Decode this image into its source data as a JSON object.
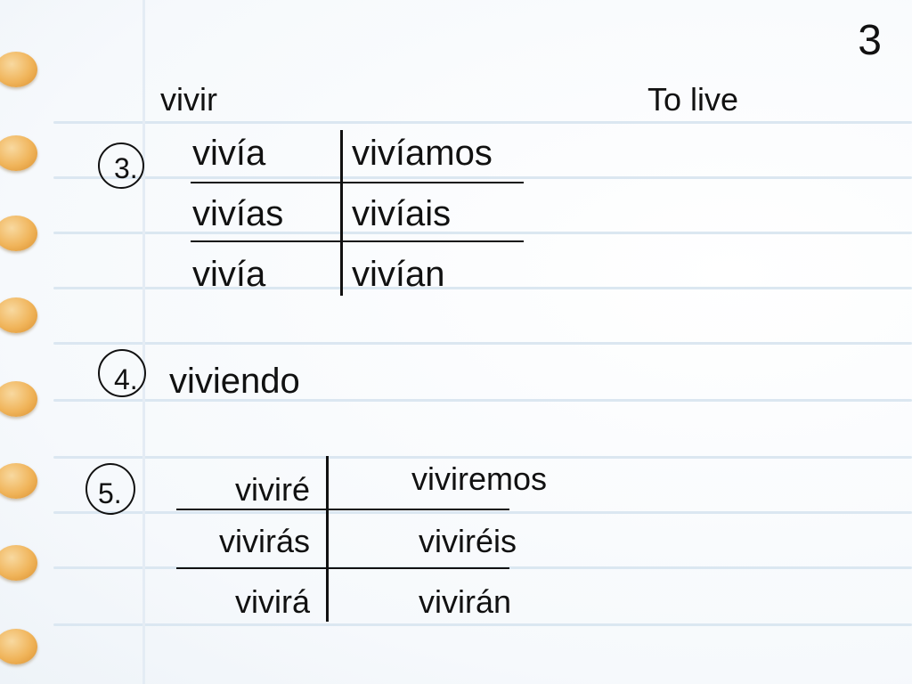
{
  "slide_number": "3",
  "verb": {
    "infinitive": "vivir",
    "translation": "To live"
  },
  "sections": {
    "imperfect": {
      "number": "3.",
      "rows": [
        [
          "vivía",
          "vivíamos"
        ],
        [
          "vivías",
          "vivíais"
        ],
        [
          "vivía",
          "vivían"
        ]
      ]
    },
    "gerund": {
      "number": "4.",
      "value": "viviendo"
    },
    "future": {
      "number": "5.",
      "rows": [
        [
          "viviré",
          "viviremos"
        ],
        [
          "vivirás",
          "viviréis"
        ],
        [
          "vivirá",
          "vivirán"
        ]
      ]
    }
  },
  "colors": {
    "hole": "#f0b45a",
    "ruled_line": "#dbe7f1",
    "ink": "#111111"
  }
}
